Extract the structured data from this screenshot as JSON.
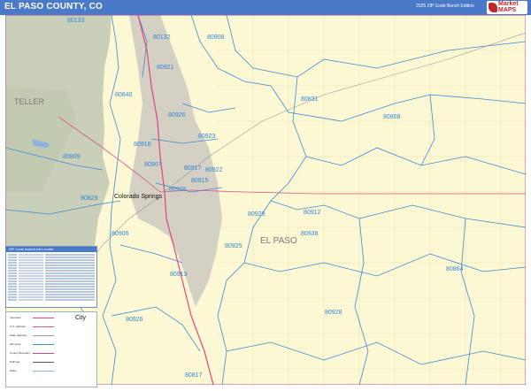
{
  "title": "EL PASO COUNTY, CO",
  "edition": "2025 ZIP Code Bench Edition",
  "logo": {
    "line1": "Market MAPS",
    "line2": ""
  },
  "map": {
    "county_label": "EL PASO",
    "neighbor_label": "TELLER",
    "city_label": "Colorado Springs",
    "zip_labels": [
      "80133",
      "80132",
      "80908",
      "80921",
      "80840",
      "80831",
      "80926",
      "80808",
      "80923",
      "80918",
      "80809",
      "80907",
      "80917",
      "80922",
      "80915",
      "80829",
      "80909",
      "80929",
      "80912",
      "80906",
      "80938",
      "80925",
      "80864",
      "80913",
      "80928",
      "80926",
      "80817"
    ]
  },
  "legend": {
    "title": "ZIP Code Index/Unit Locator"
  },
  "key": {
    "city_word": "City",
    "items": [
      "Interstate",
      "U.S. Highway",
      "State Highway",
      "ZIP Code",
      "County Boundary",
      "Railroad",
      "Water"
    ]
  },
  "colors": {
    "titlebar": "#4a7ac7",
    "land": "#fdf8d4",
    "forest": "#c9cfb8",
    "urban": "#d5d0c4",
    "zip": "#2f86d6",
    "boundary": "#3a8ad8",
    "interstate": "#e0457b"
  }
}
